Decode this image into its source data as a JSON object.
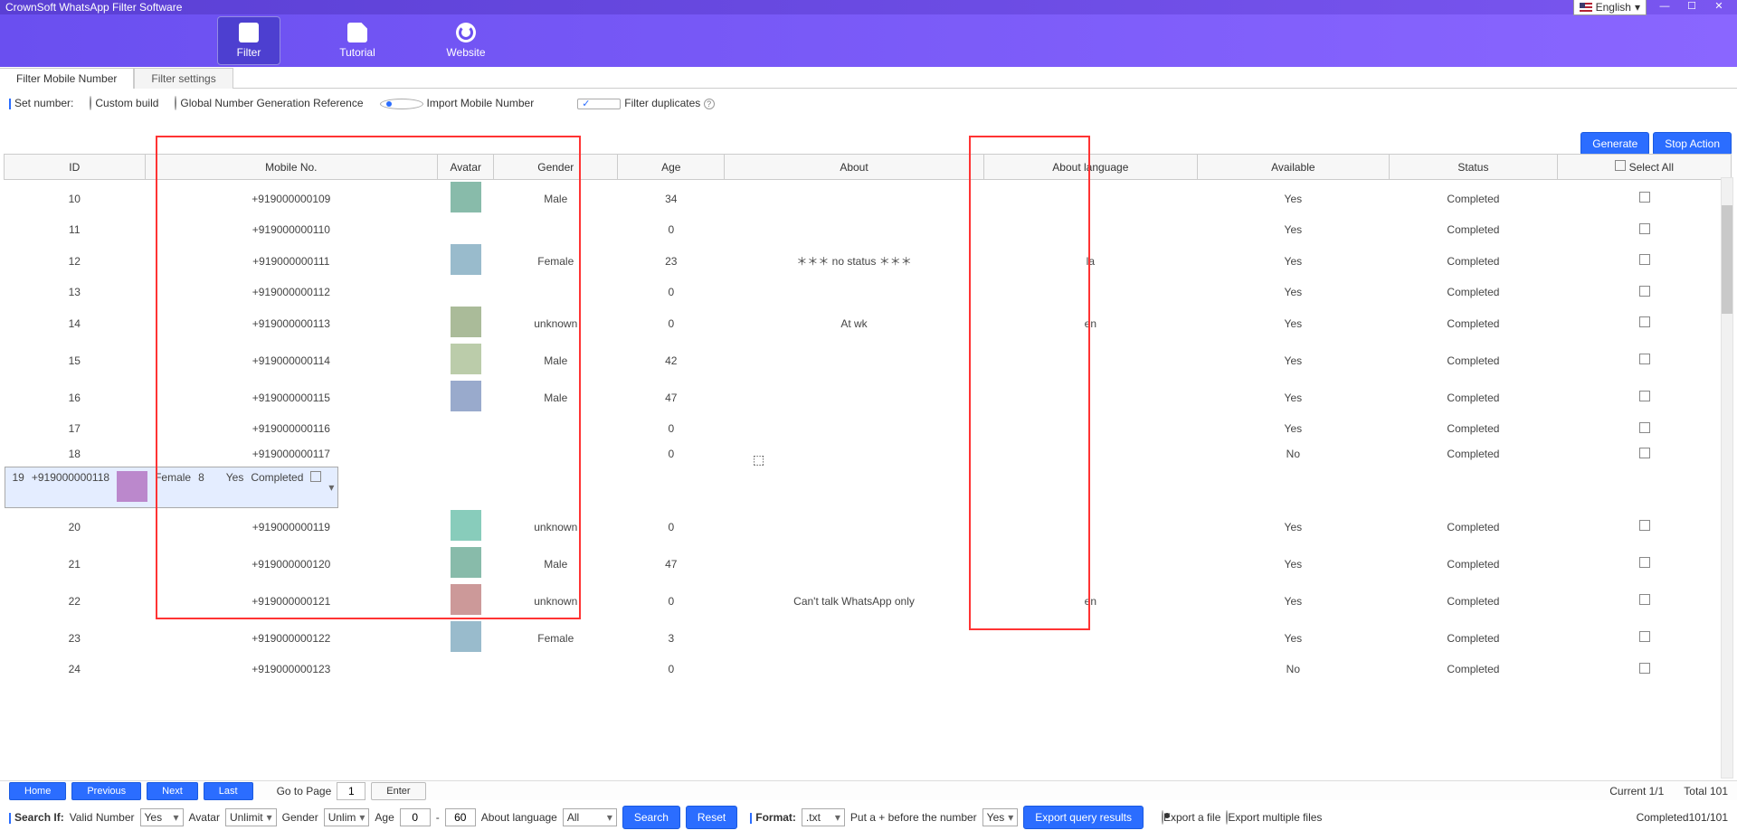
{
  "title": "CrownSoft WhatsApp Filter Software",
  "lang": "English",
  "header": {
    "filter": "Filter",
    "tutorial": "Tutorial",
    "website": "Website"
  },
  "tabs": {
    "t1": "Filter Mobile Number",
    "t2": "Filter settings"
  },
  "opt": {
    "setnum": "Set number:",
    "custom": "Custom build",
    "global": "Global Number Generation Reference",
    "import": "Import Mobile Number",
    "filterdup": "Filter duplicates"
  },
  "btn": {
    "generate": "Generate",
    "stop": "Stop Action",
    "search": "Search",
    "reset": "Reset",
    "export": "Export query results",
    "enter": "Enter",
    "home": "Home",
    "prev": "Previous",
    "next": "Next",
    "last": "Last"
  },
  "cols": {
    "id": "ID",
    "mobile": "Mobile No.",
    "avatar": "Avatar",
    "gender": "Gender",
    "age": "Age",
    "about": "About",
    "aboutlang": "About language",
    "avail": "Available",
    "status": "Status",
    "selall": "Select All"
  },
  "rows": [
    {
      "id": "10",
      "m": "+919000000109",
      "g": "Male",
      "age": "34",
      "ab": "",
      "al": "",
      "av": "Yes",
      "st": "Completed",
      "hasav": true,
      "tall": true
    },
    {
      "id": "11",
      "m": "+919000000110",
      "g": "",
      "age": "0",
      "ab": "",
      "al": "",
      "av": "Yes",
      "st": "Completed",
      "hasav": false
    },
    {
      "id": "12",
      "m": "+919000000111",
      "g": "Female",
      "age": "23",
      "ab": "＊＊＊ no status ＊＊＊",
      "al": "la",
      "av": "Yes",
      "st": "Completed",
      "hasav": true,
      "tall": true
    },
    {
      "id": "13",
      "m": "+919000000112",
      "g": "",
      "age": "0",
      "ab": "",
      "al": "",
      "av": "Yes",
      "st": "Completed",
      "hasav": false
    },
    {
      "id": "14",
      "m": "+919000000113",
      "g": "unknown",
      "age": "0",
      "ab": "At wk",
      "al": "en",
      "av": "Yes",
      "st": "Completed",
      "hasav": true,
      "tall": true
    },
    {
      "id": "15",
      "m": "+919000000114",
      "g": "Male",
      "age": "42",
      "ab": "",
      "al": "",
      "av": "Yes",
      "st": "Completed",
      "hasav": true,
      "tall": true
    },
    {
      "id": "16",
      "m": "+919000000115",
      "g": "Male",
      "age": "47",
      "ab": "",
      "al": "",
      "av": "Yes",
      "st": "Completed",
      "hasav": true,
      "tall": true
    },
    {
      "id": "17",
      "m": "+919000000116",
      "g": "",
      "age": "0",
      "ab": "",
      "al": "",
      "av": "Yes",
      "st": "Completed",
      "hasav": false
    },
    {
      "id": "18",
      "m": "+919000000117",
      "g": "",
      "age": "0",
      "ab": "",
      "al": "",
      "av": "No",
      "st": "Completed",
      "hasav": false
    },
    {
      "id": "19",
      "m": "+919000000118",
      "g": "Female",
      "age": "8",
      "ab": "",
      "al": "",
      "av": "Yes",
      "st": "Completed",
      "hasav": true,
      "sel": true,
      "tall": true
    },
    {
      "id": "20",
      "m": "+919000000119",
      "g": "unknown",
      "age": "0",
      "ab": "",
      "al": "",
      "av": "Yes",
      "st": "Completed",
      "hasav": true,
      "tall": true
    },
    {
      "id": "21",
      "m": "+919000000120",
      "g": "Male",
      "age": "47",
      "ab": "",
      "al": "",
      "av": "Yes",
      "st": "Completed",
      "hasav": true,
      "tall": true
    },
    {
      "id": "22",
      "m": "+919000000121",
      "g": "unknown",
      "age": "0",
      "ab": "Can't talk WhatsApp only",
      "al": "en",
      "av": "Yes",
      "st": "Completed",
      "hasav": true,
      "tall": true
    },
    {
      "id": "23",
      "m": "+919000000122",
      "g": "Female",
      "age": "3",
      "ab": "",
      "al": "",
      "av": "Yes",
      "st": "Completed",
      "hasav": true,
      "tall": true
    },
    {
      "id": "24",
      "m": "+919000000123",
      "g": "",
      "age": "0",
      "ab": "",
      "al": "",
      "av": "No",
      "st": "Completed",
      "hasav": false
    }
  ],
  "pager": {
    "goto": "Go to Page",
    "page": "1",
    "current": "Current 1/1",
    "total": "Total 101"
  },
  "search": {
    "lbl": "Search If:",
    "valid": "Valid Number",
    "validv": "Yes",
    "avatar": "Avatar",
    "avatarv": "Unlimit",
    "gender": "Gender",
    "genderv": "Unlim",
    "age": "Age",
    "age1": "0",
    "agedash": "-",
    "age2": "60",
    "ablang": "About language",
    "ablangv": "All",
    "format": "Format:",
    "formatv": ".txt",
    "plus": "Put a + before the number",
    "plusv": "Yes",
    "exfile": "Export a file",
    "exmulti": "Export multiple files",
    "done": "Completed101/101"
  }
}
